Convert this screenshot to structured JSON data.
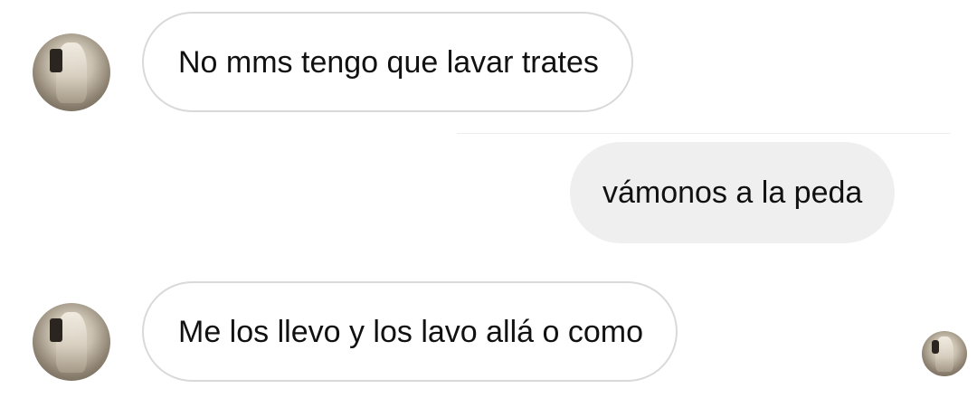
{
  "conversation": {
    "messages": [
      {
        "sender": "them",
        "text": "No mms tengo que lavar trates"
      },
      {
        "sender": "me",
        "text": "vámonos a la peda"
      },
      {
        "sender": "them",
        "text": "Me los llevo y los lavo allá o como"
      }
    ]
  },
  "colors": {
    "incoming_bubble_bg": "#ffffff",
    "incoming_bubble_border": "#d9d9d9",
    "outgoing_bubble_bg": "#efefef",
    "text": "#111111"
  }
}
